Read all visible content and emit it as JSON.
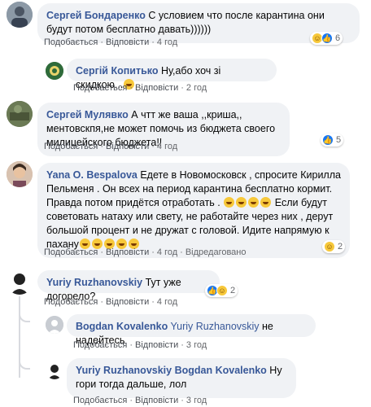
{
  "actions": {
    "like": "Подобається",
    "reply": "Відповісти",
    "separator": "·"
  },
  "comments": [
    {
      "author": "Сергей Бондаренко",
      "text": "С условием что после карантина они будут потом бесплатно давать))))))",
      "time": "4 год",
      "reactions": {
        "icons": [
          "haha-icon",
          "like-icon"
        ],
        "count": "6"
      }
    },
    {
      "author": "Сергій Копитько",
      "text": "Ну,або хоч зі скидкою...",
      "time": "2 год"
    },
    {
      "author": "Сергей Мулявко",
      "text": "А чтт же ваша ,,криша,, ментовскпя,не может помочь из бюджета своего милицейского бюджета!!",
      "time": "4 год",
      "reactions": {
        "icons": [
          "like-icon"
        ],
        "count": "5"
      }
    },
    {
      "author": "Yana O. Bespalova",
      "text_1": "Едете в Новомосковск , спросите Кирилла Пельменя . Он всех на период карантина бесплатно кормит. Правда потом придётся отработать .",
      "text_2": "Если будут советовать натаху или свету, не работайте через них , дерут большой процент и не дружат с головой. Идите напрямую к пахану",
      "time": "4 год",
      "edited": "Відредаговано",
      "reactions": {
        "icons": [
          "haha-icon"
        ],
        "count": "2"
      }
    },
    {
      "author": "Yuriy Ruzhanovskiy",
      "text": "Тут уже догорело?",
      "time": "4 год",
      "reactions": {
        "icons": [
          "like-icon",
          "haha-icon"
        ],
        "count": "2"
      }
    },
    {
      "author": "Bogdan Kovalenko",
      "mention": "Yuriy Ruzhanovskiy",
      "text": "не надейтесь",
      "time": "3 год"
    },
    {
      "author": "Yuriy Ruzhanovskiy",
      "mention": "Bogdan Kovalenko",
      "text": "Ну гори тогда дальше, лол",
      "time": "3 год"
    }
  ],
  "colors": {
    "author": "#385898",
    "bubble": "#f0f2f5",
    "meta": "#65676b",
    "like": "#1877f2",
    "haha": "#f7c83a"
  }
}
